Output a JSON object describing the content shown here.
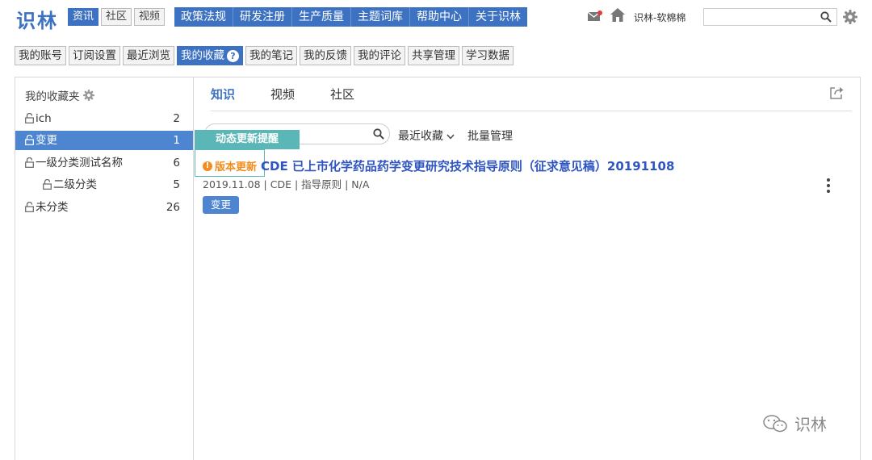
{
  "brand": {
    "logo": "识林"
  },
  "channel_tabs": [
    {
      "label": "资讯",
      "active": true
    },
    {
      "label": "社区",
      "active": false
    },
    {
      "label": "视频",
      "active": false
    }
  ],
  "main_nav": [
    "政策法规",
    "研发注册",
    "生产质量",
    "主题词库",
    "帮助中心",
    "关于识林"
  ],
  "header": {
    "user_name": "识林-软棉棉",
    "search_value": "",
    "icons": {
      "mail": "mail-icon",
      "home": "home-icon",
      "settings": "gear-icon",
      "search": "search-icon"
    }
  },
  "sub_nav": [
    {
      "label": "我的账号"
    },
    {
      "label": "订阅设置"
    },
    {
      "label": "最近浏览"
    },
    {
      "label": "我的收藏",
      "active": true,
      "badge": "?"
    },
    {
      "label": "我的笔记"
    },
    {
      "label": "我的反馈"
    },
    {
      "label": "我的评论"
    },
    {
      "label": "共享管理"
    },
    {
      "label": "学习数据"
    }
  ],
  "sidebar": {
    "title": "我的收藏夹",
    "folders": [
      {
        "name": "ich",
        "count": "2",
        "level": 1
      },
      {
        "name": "变更",
        "count": "1",
        "level": 1,
        "active": true
      },
      {
        "name": "一级分类测试名称",
        "count": "6",
        "level": 1
      },
      {
        "name": "二级分类",
        "count": "5",
        "level": 2
      },
      {
        "name": "未分类",
        "count": "26",
        "level": 1
      }
    ]
  },
  "content": {
    "tabs": [
      {
        "label": "知识",
        "active": true
      },
      {
        "label": "视频",
        "active": false
      },
      {
        "label": "社区",
        "active": false
      }
    ],
    "search_value": "",
    "sort_label": "最近收藏",
    "batch_label": "批量管理",
    "tooltip": "动态更新提醒",
    "item": {
      "badge": "版本更新",
      "title": "CDE 已上市化学药品药学变更研究技术指导原则（征求意见稿）20191108",
      "meta": "2019.11.08 | CDE | 指导原则 | N/A",
      "tag": "变更"
    }
  },
  "watermark": "识林",
  "colors": {
    "accent": "#3d72c2",
    "active_row": "#4d85d0",
    "tooltip": "#5bb7b7",
    "badge": "#f28c1e",
    "title": "#2f55c0"
  }
}
